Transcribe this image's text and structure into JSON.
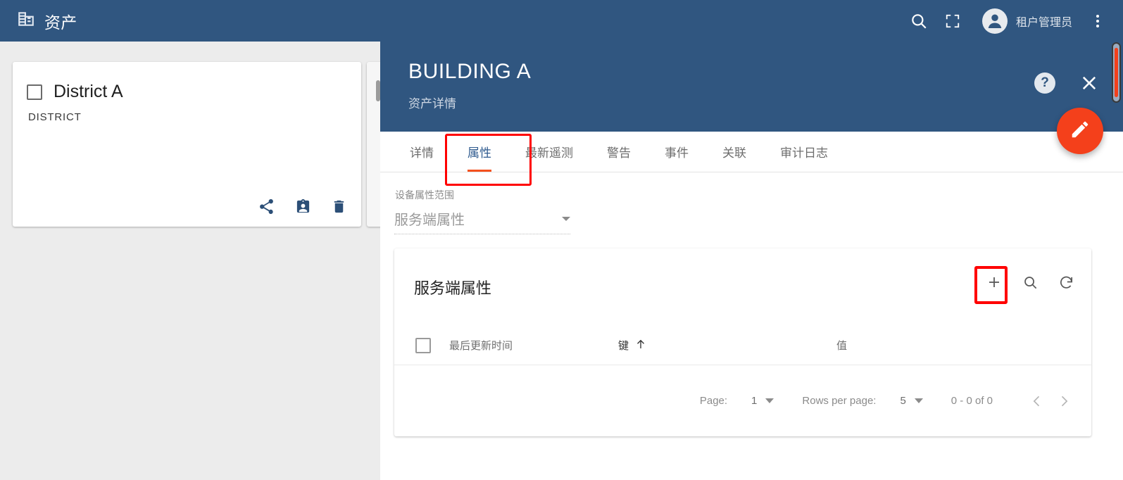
{
  "topbar": {
    "logo_icon": "building-icon",
    "title": "资产",
    "search_icon": "search-icon",
    "fullscreen_icon": "fullscreen-icon",
    "avatar_icon": "account-circle-icon",
    "user_name": "租户管理员",
    "more_icon": "more-vert-icon"
  },
  "left_list": {
    "card": {
      "checkbox_checked": false,
      "title": "District A",
      "subtitle": "DISTRICT",
      "actions": [
        {
          "name": "share-icon",
          "label": "share"
        },
        {
          "name": "assign-icon",
          "label": "assign-to-customer"
        },
        {
          "name": "delete-icon",
          "label": "delete"
        }
      ]
    }
  },
  "detail": {
    "title": "BUILDING A",
    "subtitle": "资产详情",
    "help_icon": "help-icon",
    "help_label": "?",
    "close_icon": "close-icon",
    "edit_fab_icon": "pencil-icon",
    "tabs": [
      {
        "label": "详情",
        "active": false
      },
      {
        "label": "属性",
        "active": true
      },
      {
        "label": "最新遥测",
        "active": false
      },
      {
        "label": "警告",
        "active": false
      },
      {
        "label": "事件",
        "active": false
      },
      {
        "label": "关联",
        "active": false
      },
      {
        "label": "审计日志",
        "active": false
      }
    ],
    "scope": {
      "label": "设备属性范围",
      "value": "服务端属性",
      "caret_icon": "chevron-down-icon"
    },
    "table": {
      "title": "服务端属性",
      "toolbar": [
        {
          "name": "add-icon",
          "label": "+"
        },
        {
          "name": "search-icon",
          "label": "search"
        },
        {
          "name": "refresh-icon",
          "label": "refresh"
        }
      ],
      "columns": {
        "select_all": "",
        "last_update": "最后更新时间",
        "key": "键",
        "key_sort_icon": "arrow-up-icon",
        "value": "值"
      },
      "rows": [],
      "pagination": {
        "page_label": "Page:",
        "page_value": "1",
        "rows_per_page_label": "Rows per page:",
        "rows_per_page_value": "5",
        "range": "0 - 0 of 0",
        "prev_icon": "chevron-left-icon",
        "next_icon": "chevron-right-icon"
      }
    }
  },
  "annotations": [
    {
      "name": "annotation-tab-attributes",
      "color": "#ff0000"
    },
    {
      "name": "annotation-add-attribute",
      "color": "#ff0000"
    }
  ],
  "colors": {
    "primary": "#305680",
    "accent": "#f4401b",
    "background": "#ececec"
  }
}
